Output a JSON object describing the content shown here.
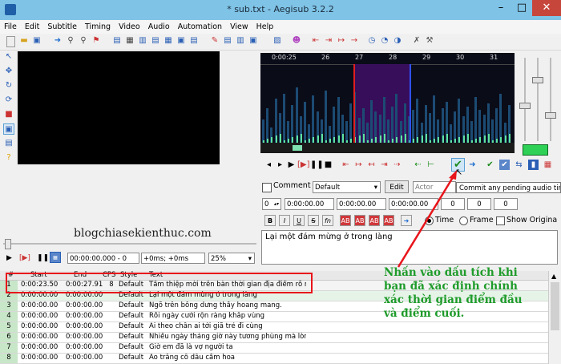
{
  "window": {
    "title": "* sub.txt - Aegisub 3.2.2"
  },
  "menu": [
    "File",
    "Edit",
    "Subtitle",
    "Timing",
    "Video",
    "Audio",
    "Automation",
    "View",
    "Help"
  ],
  "video": {
    "time": "00:00:00.000 - 0",
    "offset": "+0ms; +0ms",
    "zoom": "25%"
  },
  "audio": {
    "ticks": [
      "0:00:25",
      "26",
      "27",
      "28",
      "29",
      "30",
      "31"
    ]
  },
  "tooltip": "Commit any pending audio timing changes",
  "edit": {
    "comment_label": "Comment",
    "style": "Default",
    "edit_button": "Edit",
    "actor_placeholder": "Actor",
    "layer": "0",
    "start": "0:00:00.00",
    "end": "0:00:00.00",
    "duration": "0:00:00.00",
    "margin_l": "0",
    "margin_r": "0",
    "margin_v": "0",
    "time_label": "Time",
    "frame_label": "Frame",
    "show_original_label": "Show Origina",
    "text": "Lại một đám mừng ở trong làng",
    "format_buttons": [
      "B",
      "I",
      "U",
      "S",
      "fn",
      "AB",
      "AB",
      "AB",
      "AB"
    ]
  },
  "watermark": "blogchiasekienthuc.com",
  "annotation": "Nhấn vào dấu tích khi bạn đã xác định chính xác thời gian điểm đầu và điểm cuối.",
  "grid": {
    "headers": [
      "#",
      "Start",
      "End",
      "CPS",
      "Style",
      "Text"
    ],
    "rows": [
      {
        "n": "1",
        "start": "0:00:23.50",
        "end": "0:00:27.91",
        "cps": "8",
        "style": "Default",
        "text": "Tấm thiệp mời trên bàn thời gian địa điểm rõ ràng"
      },
      {
        "n": "2",
        "start": "0:00:00.00",
        "end": "0:00:00.00",
        "cps": "",
        "style": "Default",
        "text": "Lại một đám mừng ở trong làng"
      },
      {
        "n": "3",
        "start": "0:00:00.00",
        "end": "0:00:00.00",
        "cps": "",
        "style": "Default",
        "text": "Ngõ trên bỗng dưng thấy hoang mang."
      },
      {
        "n": "4",
        "start": "0:00:00.00",
        "end": "0:00:00.00",
        "cps": "",
        "style": "Default",
        "text": "Rồi ngày cưới rộn ràng khắp vùng"
      },
      {
        "n": "5",
        "start": "0:00:00.00",
        "end": "0:00:00.00",
        "cps": "",
        "style": "Default",
        "text": "Ai theo chân ai tới giã trẻ đi cùng"
      },
      {
        "n": "6",
        "start": "0:00:00.00",
        "end": "0:00:00.00",
        "cps": "",
        "style": "Default",
        "text": "Nhiều ngày tháng giờ này tương phùng mà lòng cay"
      },
      {
        "n": "7",
        "start": "0:00:00.00",
        "end": "0:00:00.00",
        "cps": "",
        "style": "Default",
        "text": "Giờ em đã là vợ người ta"
      },
      {
        "n": "8",
        "start": "0:00:00.00",
        "end": "0:00:00.00",
        "cps": "",
        "style": "Default",
        "text": "Áo trắng cô dâu cầm hoa"
      }
    ]
  }
}
